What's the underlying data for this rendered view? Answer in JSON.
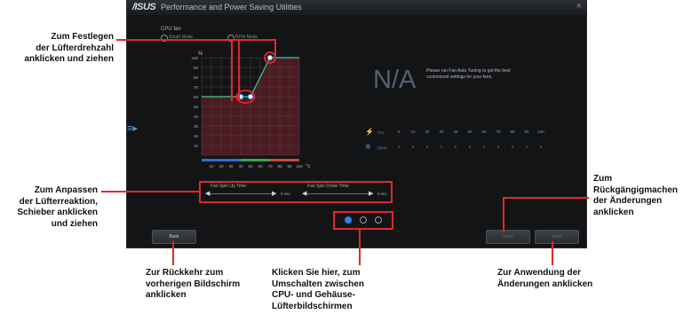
{
  "app": {
    "logo": "/ISUS",
    "title": "Performance and Power Saving Utilities",
    "close": "×",
    "sidebar_icon": "≡▸",
    "cpu_fan_label": "CPU fan",
    "modes": [
      "Smart Mode",
      "RPM Mode"
    ],
    "na_text": "N/A",
    "info_text": "Please run Fan Auto Tuning to get the best customized settings for your fans.",
    "fan_table": {
      "percent_unit": "(%)",
      "rpm_unit": "(rpm)",
      "percent_values": [
        "0",
        "10",
        "20",
        "30",
        "40",
        "50",
        "60",
        "70",
        "80",
        "90",
        "100"
      ],
      "rpm_values": [
        "0",
        "0",
        "0",
        "0",
        "0",
        "0",
        "0",
        "0",
        "0",
        "0",
        "0"
      ]
    },
    "spin_up": {
      "label": "Fan Spin Up Time:",
      "value": "0 sec"
    },
    "spin_down": {
      "label": "Fan Spin Down Time:",
      "value": "0 sec"
    },
    "buttons": {
      "back": "Back",
      "undo": "Undo",
      "apply": "Apply"
    }
  },
  "chart_data": {
    "type": "line",
    "x": [
      0,
      40,
      50,
      70,
      80,
      100
    ],
    "y": [
      60,
      60,
      60,
      100,
      100,
      100
    ],
    "xticks": [
      "10",
      "20",
      "30",
      "40",
      "50",
      "60",
      "70",
      "80",
      "90",
      "100"
    ],
    "yticks": [
      "10",
      "20",
      "30",
      "40",
      "50",
      "60",
      "70",
      "80",
      "90",
      "100"
    ],
    "ylabel": "%",
    "xlabel": "°c",
    "xlim": [
      0,
      100
    ],
    "ylim": [
      0,
      100
    ],
    "grid": true,
    "line_color": "#3ecda0",
    "fill_color": "#4a1c22"
  },
  "callouts": {
    "drag_points": "Zum Festlegen\nder Lüfterdrehzahl\nanklicken und ziehen",
    "slider": "Zum Anpassen\nder Lüfterreaktion,\nSchieber anklicken\nund ziehen",
    "back": "Zur Rückkehr zum\nvorherigen Bildschirm\nanklicken",
    "switch": "Klicken Sie hier, zum\nUmschalten zwischen\nCPU- und Gehäuse-\nLüfterbildschirmen",
    "undo": "Zum\nRückgängigmachen\nder Änderungen\nanklicken",
    "apply": "Zur Anwendung der\nÄnderungen anklicken"
  }
}
